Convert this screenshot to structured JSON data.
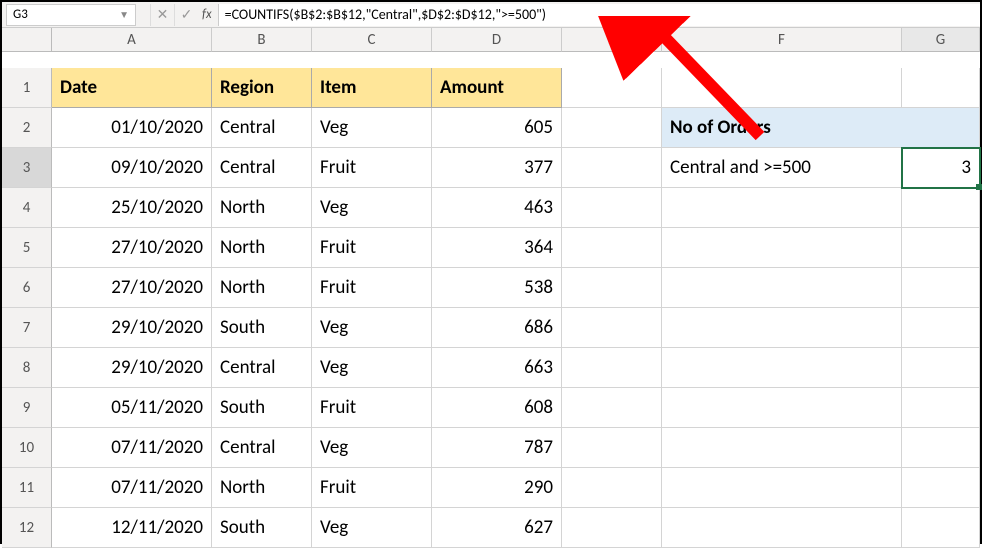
{
  "active_cell": "G3",
  "formula": "=COUNTIFS($B$2:$B$12,\"Central\",$D$2:$D$12,\">=500\")",
  "columns": [
    "A",
    "B",
    "C",
    "D",
    "E",
    "F",
    "G"
  ],
  "row_numbers": [
    1,
    2,
    3,
    4,
    5,
    6,
    7,
    8,
    9,
    10,
    11,
    12
  ],
  "headers": {
    "A": "Date",
    "B": "Region",
    "C": "Item",
    "D": "Amount"
  },
  "data_rows": [
    {
      "date": "01/10/2020",
      "region": "Central",
      "item": "Veg",
      "amount": 605
    },
    {
      "date": "09/10/2020",
      "region": "Central",
      "item": "Fruit",
      "amount": 377
    },
    {
      "date": "25/10/2020",
      "region": "North",
      "item": "Veg",
      "amount": 463
    },
    {
      "date": "27/10/2020",
      "region": "North",
      "item": "Fruit",
      "amount": 364
    },
    {
      "date": "27/10/2020",
      "region": "North",
      "item": "Fruit",
      "amount": 538
    },
    {
      "date": "29/10/2020",
      "region": "South",
      "item": "Veg",
      "amount": 686
    },
    {
      "date": "29/10/2020",
      "region": "Central",
      "item": "Veg",
      "amount": 663
    },
    {
      "date": "05/11/2020",
      "region": "South",
      "item": "Fruit",
      "amount": 608
    },
    {
      "date": "07/11/2020",
      "region": "Central",
      "item": "Veg",
      "amount": 787
    },
    {
      "date": "07/11/2020",
      "region": "North",
      "item": "Fruit",
      "amount": 290
    },
    {
      "date": "12/11/2020",
      "region": "South",
      "item": "Veg",
      "amount": 627
    }
  ],
  "side": {
    "title": "No of Orders",
    "label": "Central and >=500",
    "result": 3
  },
  "fx_label": "fx"
}
